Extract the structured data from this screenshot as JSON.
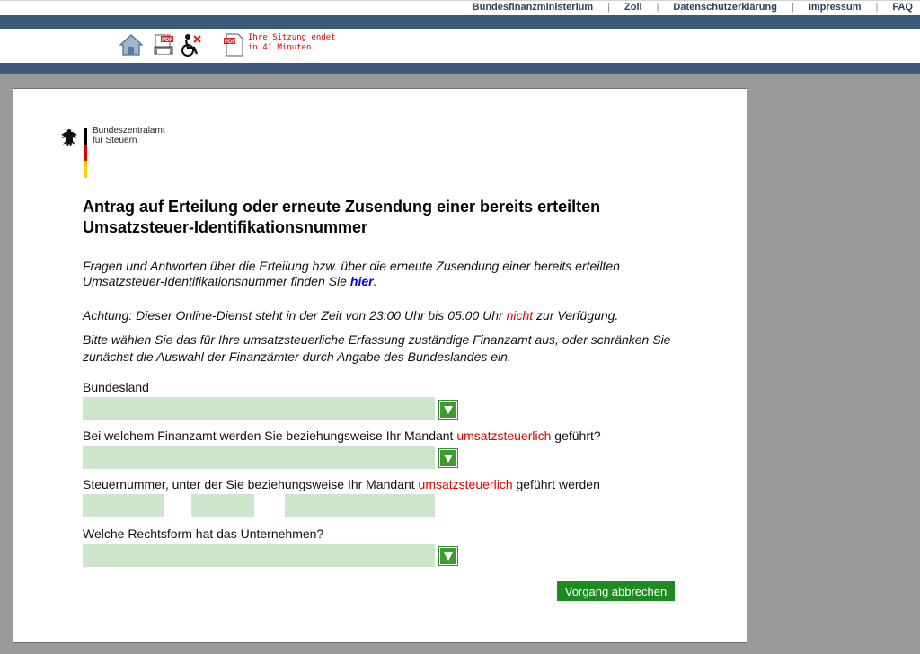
{
  "top_links": [
    "Bundesfinanzministerium",
    "Zoll",
    "Datenschutzerklärung",
    "Impressum",
    "FAQ"
  ],
  "top_separator": "|",
  "toolbar": {
    "session_line1": "Ihre Sitzung endet",
    "session_line2": "in 41 Minuten.",
    "icons": [
      "home-icon",
      "pdf-print-icon",
      "accessibility-icon",
      "pdf-document-icon"
    ]
  },
  "logo": {
    "line1": "Bundeszentralamt",
    "line2": "für Steuern"
  },
  "heading": "Antrag auf Erteilung oder erneute Zusendung einer bereits erteilten Umsatzsteuer-Identifikationsnummer",
  "faq": {
    "text": "Fragen und Antworten über die Erteilung bzw. über die erneute Zusendung einer bereits erteilten Umsatzsteuer-Identifikationsnummer finden Sie",
    "link": "hier",
    "end": "."
  },
  "warning": {
    "before": "Achtung: Dieser Online-Dienst steht in der Zeit von 23:00 Uhr bis 05:00 Uhr",
    "highlight": "nicht",
    "after": "zur Verfügung."
  },
  "instructions": "Bitte wählen Sie das für Ihre umsatzsteuerliche Erfassung zuständige Finanzamt aus, oder schränken Sie zunächst die Auswahl der Finanzämter durch Angabe des Bundeslandes ein.",
  "form": {
    "bundesland_label": "Bundesland",
    "bundesland_value": "",
    "finanzamt_label_before": "Bei welchem Finanzamt werden Sie beziehungsweise Ihr Mandant",
    "finanzamt_label_highlight": "umsatzsteuerlich",
    "finanzamt_label_after": "geführt?",
    "finanzamt_value": "",
    "steuernummer_label_before": "Steuernummer, unter der Sie beziehungsweise Ihr Mandant",
    "steuernummer_label_highlight": "umsatzsteuerlich",
    "steuernummer_label_after": "geführt werden",
    "steuernummer_parts": [
      "",
      "",
      ""
    ],
    "rechtsform_label": "Welche Rechtsform hat das Unternehmen?",
    "rechtsform_value": ""
  },
  "cancel_button": "Vorgang abbrechen",
  "colors": {
    "header_blue": "#3e5a7a",
    "field_green": "#cce6cc",
    "button_green": "#1f8a1f",
    "highlight_red": "#e00000",
    "link_blue": "#0000ee"
  }
}
